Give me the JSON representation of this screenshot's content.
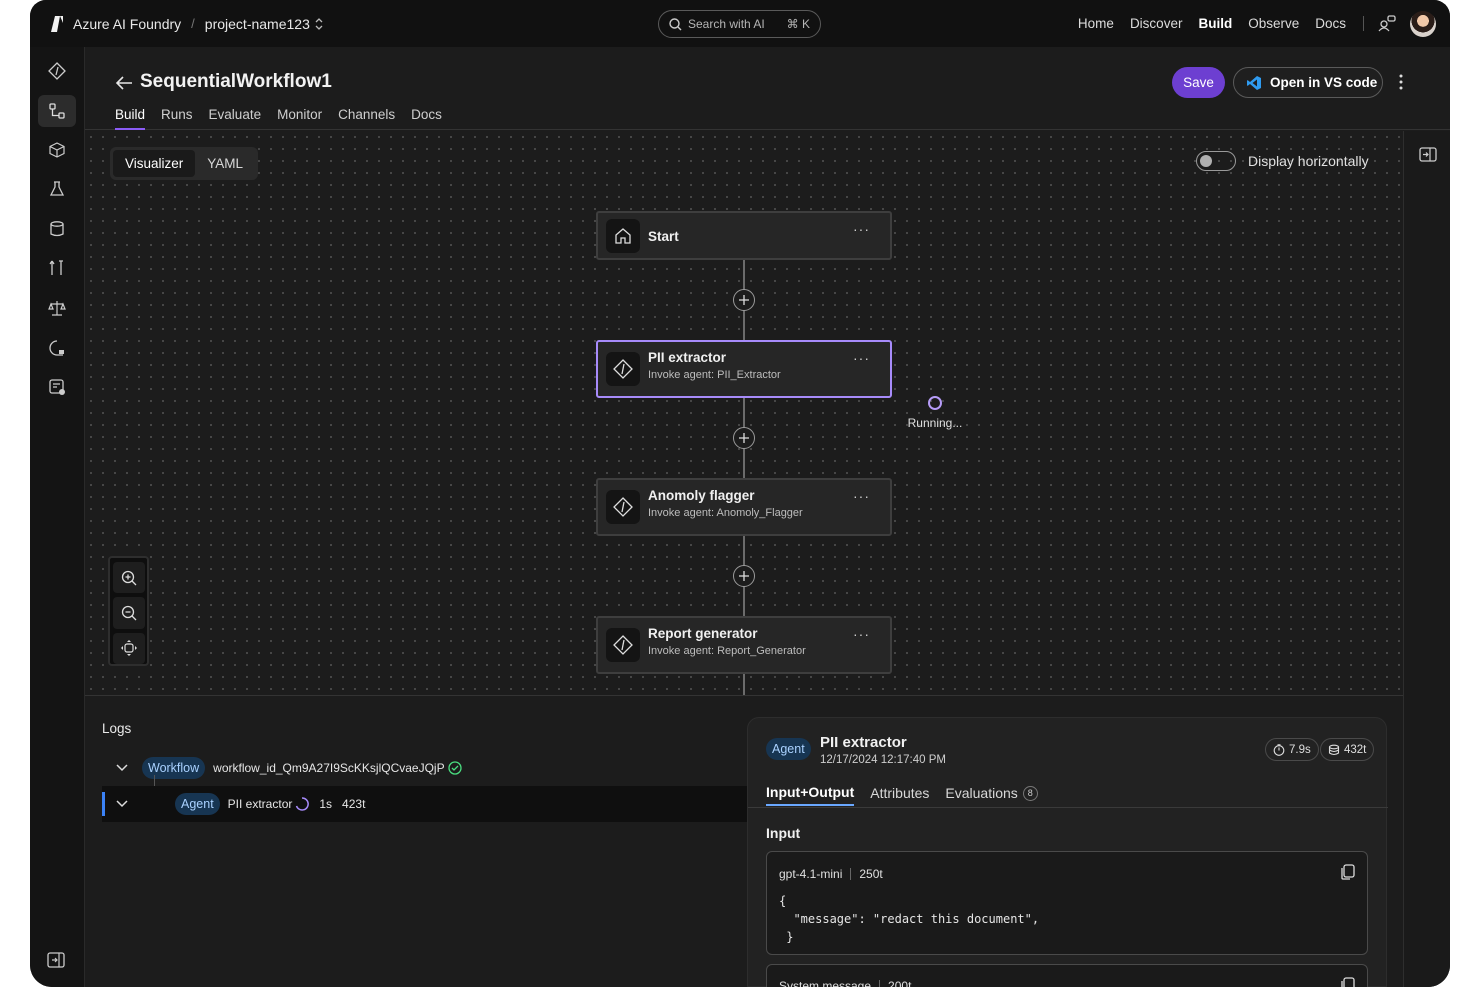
{
  "topbar": {
    "app_name": "Azure AI Foundry",
    "separator": "/",
    "project": "project-name123",
    "search_placeholder": "Search with AI",
    "search_shortcut": "⌘ K",
    "nav": [
      "Home",
      "Discover",
      "Build",
      "Observe",
      "Docs"
    ],
    "active_nav": "Build"
  },
  "header": {
    "title": "SequentialWorkflow1",
    "tabs": [
      "Build",
      "Runs",
      "Evaluate",
      "Monitor",
      "Channels",
      "Docs"
    ],
    "active_tab": "Build",
    "save_label": "Save",
    "vscode_label": "Open in VS code"
  },
  "canvas": {
    "view_modes": [
      "Visualizer",
      "YAML"
    ],
    "active_view": "Visualizer",
    "toggle_label": "Display horizontally",
    "toggle_on": false,
    "nodes": [
      {
        "title": "Start",
        "subtitle": ""
      },
      {
        "title": "PII extractor",
        "subtitle": "Invoke agent: PII_Extractor"
      },
      {
        "title": "Anomoly flagger",
        "subtitle": "Invoke agent: Anomoly_Flagger"
      },
      {
        "title": "Report generator",
        "subtitle": "Invoke agent: Report_Generator"
      }
    ],
    "running_label": "Running..."
  },
  "logs": {
    "title": "Logs",
    "rows": [
      {
        "pill": "Workflow",
        "text": "workflow_id_Qm9A27I9ScKKsjlQCvaeJQjP",
        "duration": "",
        "tokens": ""
      },
      {
        "pill": "Agent",
        "text": "PII extractor",
        "duration": "1s",
        "tokens": "423t"
      }
    ]
  },
  "detail": {
    "pill": "Agent",
    "title": "PII extractor",
    "timestamp": "12/17/2024 12:17:40 PM",
    "time_metric": "7.9s",
    "token_metric": "432t",
    "tabs": [
      "Input+Output",
      "Attributes",
      "Evaluations"
    ],
    "evaluations_count": "8",
    "input_label": "Input",
    "model": "gpt-4.1-mini",
    "model_tokens": "250t",
    "code_lines": [
      "{",
      "  \"message\": \"redact this document\",",
      " }"
    ],
    "system_label": "System message",
    "system_tokens": "200t"
  },
  "colors": {
    "accent": "#6d3fd1",
    "active_node_border": "#a78bfa",
    "pill_bg": "#173552"
  }
}
